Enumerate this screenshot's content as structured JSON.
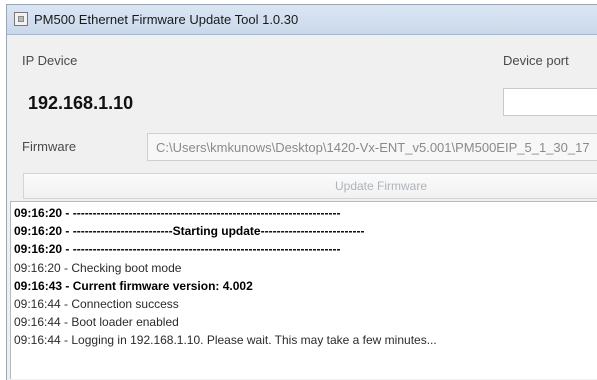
{
  "window": {
    "title": "PM500 Ethernet Firmware Update Tool 1.0.30",
    "icon": "app-icon"
  },
  "ip_device": {
    "label": "IP Device",
    "value": "192.168.1.10"
  },
  "device_port": {
    "label": "Device port",
    "value": ""
  },
  "firmware": {
    "label": "Firmware",
    "path": "C:\\Users\\kmkunows\\Desktop\\1420-Vx-ENT_v5.001\\PM500EIP_5_1_30_17"
  },
  "update_button": {
    "label": "Update Firmware",
    "enabled": false
  },
  "log": {
    "lines": [
      {
        "text": "09:16:20 - -------------------------------------------------------------------",
        "bold": true
      },
      {
        "text": "09:16:20 - -------------------------Starting update--------------------------",
        "bold": true
      },
      {
        "text": "09:16:20 - -------------------------------------------------------------------",
        "bold": true
      },
      {
        "text": "09:16:20 - Checking boot mode",
        "bold": false
      },
      {
        "text": "09:16:43 - Current firmware version: 4.002",
        "bold": true
      },
      {
        "text": "09:16:44 - Connection success",
        "bold": false
      },
      {
        "text": "09:16:44 - Boot loader enabled",
        "bold": false
      },
      {
        "text": "09:16:44 - Logging in 192.168.1.10. Please wait. This may take a few minutes...",
        "bold": false
      }
    ]
  }
}
